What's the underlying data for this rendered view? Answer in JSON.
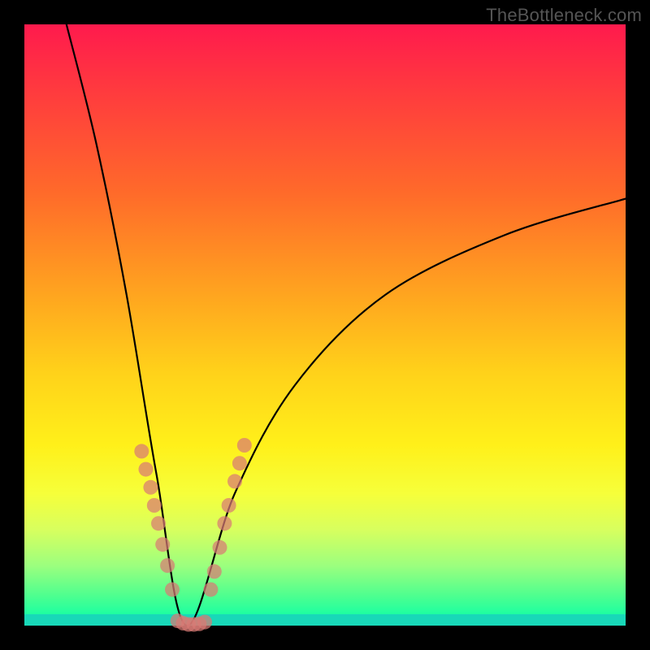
{
  "watermark": "TheBottleneck.com",
  "chart_data": {
    "type": "line",
    "title": "",
    "xlabel": "",
    "ylabel": "",
    "xlim": [
      0,
      100
    ],
    "ylim": [
      0,
      100
    ],
    "curve": {
      "description": "V-shaped bottleneck curve with minimum (zero) near x≈27; left branch steep, right branch shallower asymptote",
      "min_x": 27,
      "left_branch_sample": [
        {
          "x": 7,
          "y": 100
        },
        {
          "x": 12,
          "y": 80
        },
        {
          "x": 17,
          "y": 55
        },
        {
          "x": 22,
          "y": 25
        },
        {
          "x": 27,
          "y": 0
        }
      ],
      "right_branch_sample": [
        {
          "x": 27,
          "y": 0
        },
        {
          "x": 35,
          "y": 22
        },
        {
          "x": 45,
          "y": 40
        },
        {
          "x": 60,
          "y": 55
        },
        {
          "x": 80,
          "y": 65
        },
        {
          "x": 100,
          "y": 71
        }
      ]
    },
    "series": [
      {
        "name": "points-left",
        "points": [
          {
            "x": 19.5,
            "y": 29
          },
          {
            "x": 20.2,
            "y": 26
          },
          {
            "x": 21.0,
            "y": 23
          },
          {
            "x": 21.6,
            "y": 20
          },
          {
            "x": 22.3,
            "y": 17
          },
          {
            "x": 23.0,
            "y": 13.5
          },
          {
            "x": 23.8,
            "y": 10
          },
          {
            "x": 24.6,
            "y": 6
          }
        ]
      },
      {
        "name": "points-trough",
        "points": [
          {
            "x": 25.5,
            "y": 0.8
          },
          {
            "x": 26.4,
            "y": 0.4
          },
          {
            "x": 27.3,
            "y": 0.2
          },
          {
            "x": 28.2,
            "y": 0.2
          },
          {
            "x": 29.1,
            "y": 0.3
          },
          {
            "x": 30.0,
            "y": 0.6
          }
        ]
      },
      {
        "name": "points-right",
        "points": [
          {
            "x": 31.0,
            "y": 6
          },
          {
            "x": 31.6,
            "y": 9
          },
          {
            "x": 32.5,
            "y": 13
          },
          {
            "x": 33.3,
            "y": 17
          },
          {
            "x": 34.0,
            "y": 20
          },
          {
            "x": 35.0,
            "y": 24
          },
          {
            "x": 35.8,
            "y": 27
          },
          {
            "x": 36.6,
            "y": 30
          }
        ]
      }
    ],
    "background_gradient": {
      "top": "#ff1a4d",
      "mid": "#ffd21a",
      "bottom_band": "#18d8b8"
    }
  }
}
